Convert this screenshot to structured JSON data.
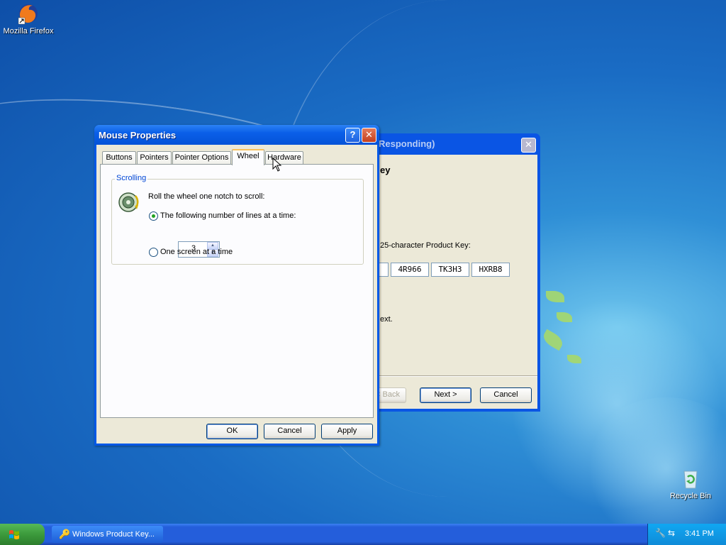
{
  "desktop": {
    "firefox_label": "Mozilla Firefox",
    "recycle_label": "Recycle Bin"
  },
  "wizard": {
    "title": "Responding)",
    "heading": "ey",
    "instruction": "25-character Product Key:",
    "key_parts": [
      "",
      "4R966",
      "TK3H3",
      "HXRB8"
    ],
    "next_hint": "ext.",
    "back_label": "< Back",
    "next_label": "Next >",
    "cancel_label": "Cancel"
  },
  "dialog": {
    "title": "Mouse Properties",
    "tabs": [
      "Buttons",
      "Pointers",
      "Pointer Options",
      "Wheel",
      "Hardware"
    ],
    "active_tab": "Wheel",
    "group_label": "Scrolling",
    "instruction": "Roll the wheel one notch to scroll:",
    "option_lines": "The following number of lines at a time:",
    "lines_value": "3",
    "option_screen": "One screen at a time",
    "selected_option": "lines",
    "ok_label": "OK",
    "cancel_label": "Cancel",
    "apply_label": "Apply"
  },
  "taskbar": {
    "start_label": "",
    "task_label": "Windows Product Key...",
    "clock": "3:41 PM"
  },
  "colors": {
    "title_blue": "#0058e6",
    "dialog_bg": "#ece9d8",
    "group_label": "#0046d5",
    "close_red": "#c43f1e",
    "start_green": "#3c9a3c"
  }
}
